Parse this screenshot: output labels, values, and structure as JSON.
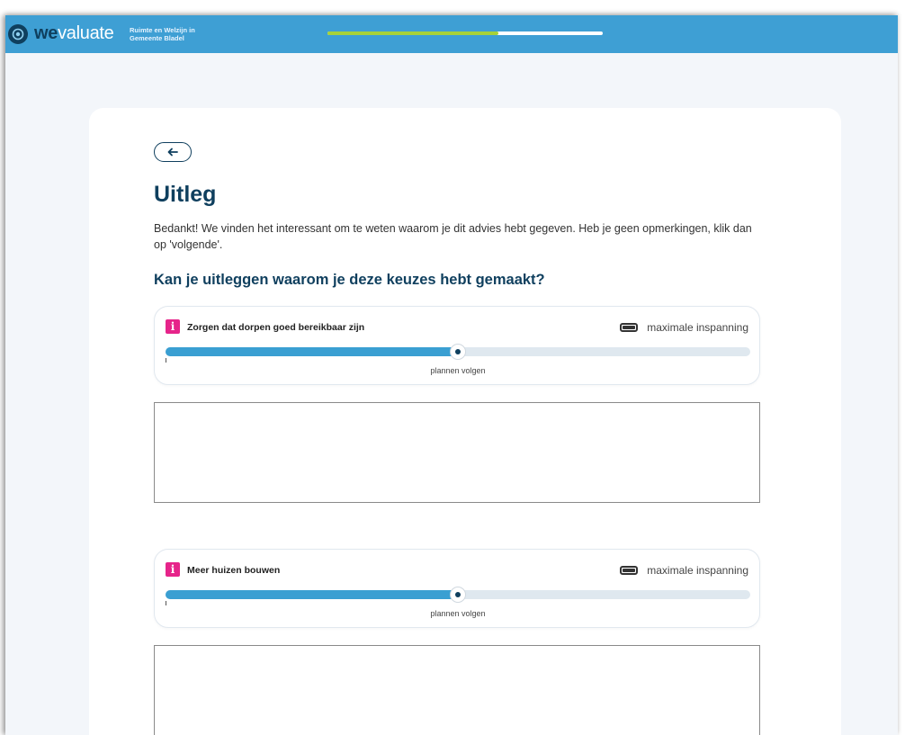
{
  "header": {
    "logo_bold": "we",
    "logo_light": "valuate",
    "org_line1": "Ruimte en Welzijn in",
    "org_line2": "Gemeente Bladel",
    "progress": 0.62,
    "progress_color": "#a6d239",
    "bar_color": "#3e9fd4"
  },
  "page": {
    "back_icon": "arrow-left-icon",
    "title": "Uitleg",
    "intro": "Bedankt! We vinden het interessant om te weten waarom je dit advies hebt gegeven. Heb je geen opmerkingen, klik dan op 'volgende'.",
    "question": "Kan je uitleggen waarom je deze keuzes hebt gemaakt?"
  },
  "items": [
    {
      "label": "Zorgen dat dorpen goed bereikbaar zijn",
      "info": "i",
      "effort_label": "maximale inspanning",
      "slider_value": 0.5,
      "marker_label": "plannen volgen",
      "comment": ""
    },
    {
      "label": "Meer huizen bouwen",
      "info": "i",
      "effort_label": "maximale inspanning",
      "slider_value": 0.5,
      "marker_label": "plannen volgen",
      "comment": ""
    }
  ]
}
